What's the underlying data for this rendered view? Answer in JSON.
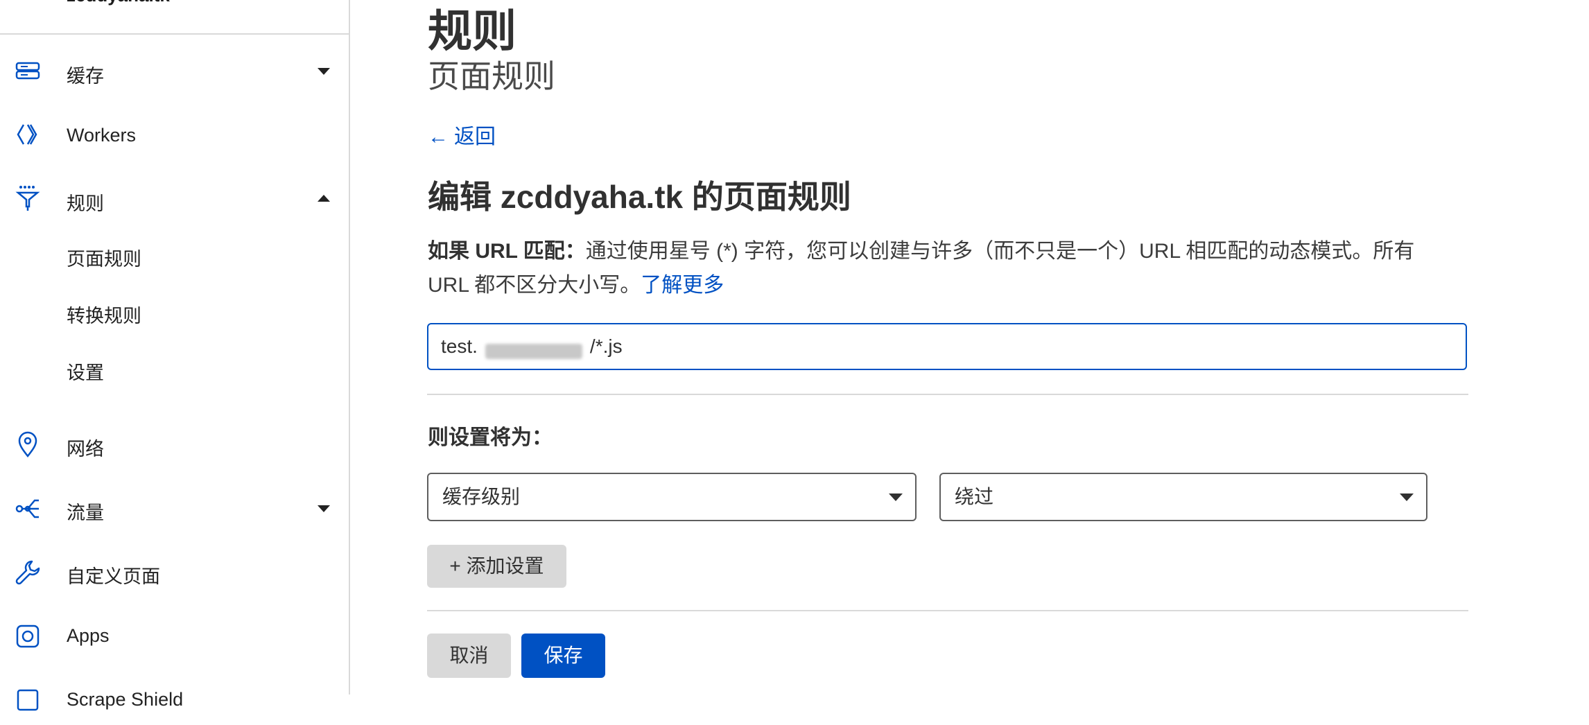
{
  "sidebar": {
    "top_label": "zcddyaha.tk",
    "items": [
      {
        "label": "缓存",
        "icon": "server-stack-icon",
        "expanded": false
      },
      {
        "label": "Workers",
        "icon": "workers-icon"
      },
      {
        "label": "规则",
        "icon": "rules-funnel-icon",
        "expanded": true
      },
      {
        "label": "网络",
        "icon": "location-pin-icon"
      },
      {
        "label": "流量",
        "icon": "traffic-share-icon",
        "expanded": false
      },
      {
        "label": "自定义页面",
        "icon": "wrench-icon"
      },
      {
        "label": "Apps",
        "icon": "apps-icon"
      },
      {
        "label": "Scrape Shield",
        "icon": "shield-doc-icon"
      }
    ],
    "rules_sub": [
      "页面规则",
      "转换规则",
      "设置"
    ]
  },
  "header": {
    "title": "规则",
    "subtitle": "页面规则"
  },
  "back_label": "返回",
  "edit_title": "编辑 zcddyaha.tk 的页面规则",
  "description": {
    "lead": "如果 URL 匹配：",
    "text": "通过使用星号 (*) 字符，您可以创建与许多（而不只是一个）URL 相匹配的动态模式。所有 URL 都不区分大小写。",
    "link": "了解更多"
  },
  "url_field": {
    "value_prefix": "test.",
    "value_suffix": "/*.js"
  },
  "settings_label": "则设置将为：",
  "setting_row": {
    "setting_select": "缓存级别",
    "value_select": "绕过"
  },
  "add_setting_label": "+ 添加设置",
  "cancel_label": "取消",
  "save_label": "保存",
  "colors": {
    "accent": "#0051c3",
    "text": "#313131",
    "border": "#d9d9d9"
  }
}
